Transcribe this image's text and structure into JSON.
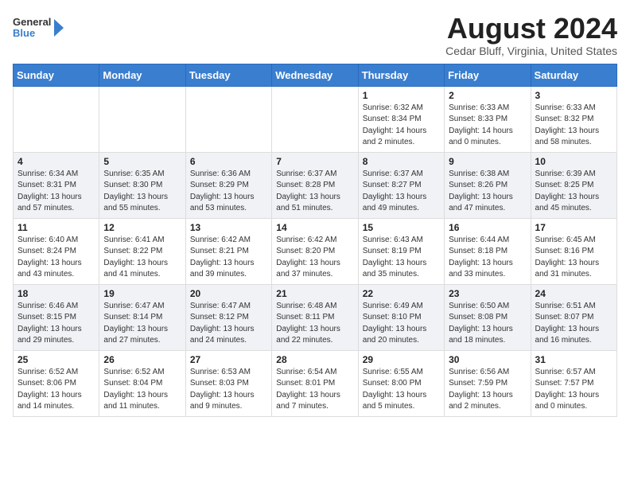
{
  "header": {
    "logo_general": "General",
    "logo_blue": "Blue",
    "main_title": "August 2024",
    "sub_title": "Cedar Bluff, Virginia, United States"
  },
  "calendar": {
    "days_of_week": [
      "Sunday",
      "Monday",
      "Tuesday",
      "Wednesday",
      "Thursday",
      "Friday",
      "Saturday"
    ],
    "weeks": [
      [
        {
          "day": "",
          "info": ""
        },
        {
          "day": "",
          "info": ""
        },
        {
          "day": "",
          "info": ""
        },
        {
          "day": "",
          "info": ""
        },
        {
          "day": "1",
          "info": "Sunrise: 6:32 AM\nSunset: 8:34 PM\nDaylight: 14 hours\nand 2 minutes."
        },
        {
          "day": "2",
          "info": "Sunrise: 6:33 AM\nSunset: 8:33 PM\nDaylight: 14 hours\nand 0 minutes."
        },
        {
          "day": "3",
          "info": "Sunrise: 6:33 AM\nSunset: 8:32 PM\nDaylight: 13 hours\nand 58 minutes."
        }
      ],
      [
        {
          "day": "4",
          "info": "Sunrise: 6:34 AM\nSunset: 8:31 PM\nDaylight: 13 hours\nand 57 minutes."
        },
        {
          "day": "5",
          "info": "Sunrise: 6:35 AM\nSunset: 8:30 PM\nDaylight: 13 hours\nand 55 minutes."
        },
        {
          "day": "6",
          "info": "Sunrise: 6:36 AM\nSunset: 8:29 PM\nDaylight: 13 hours\nand 53 minutes."
        },
        {
          "day": "7",
          "info": "Sunrise: 6:37 AM\nSunset: 8:28 PM\nDaylight: 13 hours\nand 51 minutes."
        },
        {
          "day": "8",
          "info": "Sunrise: 6:37 AM\nSunset: 8:27 PM\nDaylight: 13 hours\nand 49 minutes."
        },
        {
          "day": "9",
          "info": "Sunrise: 6:38 AM\nSunset: 8:26 PM\nDaylight: 13 hours\nand 47 minutes."
        },
        {
          "day": "10",
          "info": "Sunrise: 6:39 AM\nSunset: 8:25 PM\nDaylight: 13 hours\nand 45 minutes."
        }
      ],
      [
        {
          "day": "11",
          "info": "Sunrise: 6:40 AM\nSunset: 8:24 PM\nDaylight: 13 hours\nand 43 minutes."
        },
        {
          "day": "12",
          "info": "Sunrise: 6:41 AM\nSunset: 8:22 PM\nDaylight: 13 hours\nand 41 minutes."
        },
        {
          "day": "13",
          "info": "Sunrise: 6:42 AM\nSunset: 8:21 PM\nDaylight: 13 hours\nand 39 minutes."
        },
        {
          "day": "14",
          "info": "Sunrise: 6:42 AM\nSunset: 8:20 PM\nDaylight: 13 hours\nand 37 minutes."
        },
        {
          "day": "15",
          "info": "Sunrise: 6:43 AM\nSunset: 8:19 PM\nDaylight: 13 hours\nand 35 minutes."
        },
        {
          "day": "16",
          "info": "Sunrise: 6:44 AM\nSunset: 8:18 PM\nDaylight: 13 hours\nand 33 minutes."
        },
        {
          "day": "17",
          "info": "Sunrise: 6:45 AM\nSunset: 8:16 PM\nDaylight: 13 hours\nand 31 minutes."
        }
      ],
      [
        {
          "day": "18",
          "info": "Sunrise: 6:46 AM\nSunset: 8:15 PM\nDaylight: 13 hours\nand 29 minutes."
        },
        {
          "day": "19",
          "info": "Sunrise: 6:47 AM\nSunset: 8:14 PM\nDaylight: 13 hours\nand 27 minutes."
        },
        {
          "day": "20",
          "info": "Sunrise: 6:47 AM\nSunset: 8:12 PM\nDaylight: 13 hours\nand 24 minutes."
        },
        {
          "day": "21",
          "info": "Sunrise: 6:48 AM\nSunset: 8:11 PM\nDaylight: 13 hours\nand 22 minutes."
        },
        {
          "day": "22",
          "info": "Sunrise: 6:49 AM\nSunset: 8:10 PM\nDaylight: 13 hours\nand 20 minutes."
        },
        {
          "day": "23",
          "info": "Sunrise: 6:50 AM\nSunset: 8:08 PM\nDaylight: 13 hours\nand 18 minutes."
        },
        {
          "day": "24",
          "info": "Sunrise: 6:51 AM\nSunset: 8:07 PM\nDaylight: 13 hours\nand 16 minutes."
        }
      ],
      [
        {
          "day": "25",
          "info": "Sunrise: 6:52 AM\nSunset: 8:06 PM\nDaylight: 13 hours\nand 14 minutes."
        },
        {
          "day": "26",
          "info": "Sunrise: 6:52 AM\nSunset: 8:04 PM\nDaylight: 13 hours\nand 11 minutes."
        },
        {
          "day": "27",
          "info": "Sunrise: 6:53 AM\nSunset: 8:03 PM\nDaylight: 13 hours\nand 9 minutes."
        },
        {
          "day": "28",
          "info": "Sunrise: 6:54 AM\nSunset: 8:01 PM\nDaylight: 13 hours\nand 7 minutes."
        },
        {
          "day": "29",
          "info": "Sunrise: 6:55 AM\nSunset: 8:00 PM\nDaylight: 13 hours\nand 5 minutes."
        },
        {
          "day": "30",
          "info": "Sunrise: 6:56 AM\nSunset: 7:59 PM\nDaylight: 13 hours\nand 2 minutes."
        },
        {
          "day": "31",
          "info": "Sunrise: 6:57 AM\nSunset: 7:57 PM\nDaylight: 13 hours\nand 0 minutes."
        }
      ]
    ]
  }
}
